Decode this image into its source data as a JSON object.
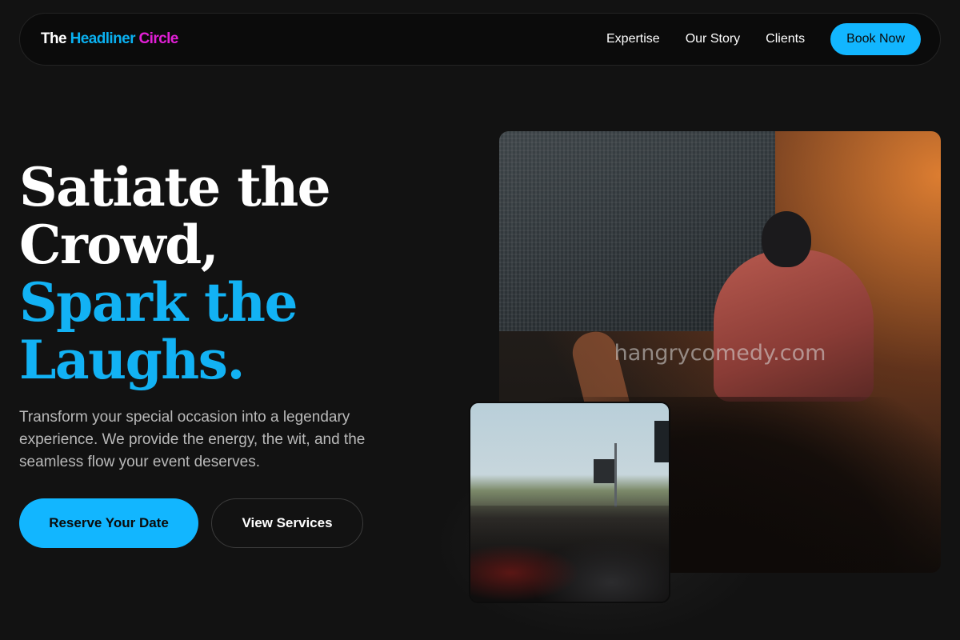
{
  "nav": {
    "logo": {
      "part1": "The",
      "part2": "Headliner",
      "part3": "Circle"
    },
    "links": [
      "Expertise",
      "Our Story",
      "Clients"
    ],
    "cta": "Book Now"
  },
  "hero": {
    "headline_line1": "Satiate the",
    "headline_line2": "Crowd,",
    "headline_line3": "Spark the",
    "headline_line4": "Laughs.",
    "subtitle": "Transform your special occasion into a legendary experience. We provide the energy, the wit, and the seamless flow your event deserves.",
    "primary_button": "Reserve Your Date",
    "secondary_button": "View Services"
  },
  "images": {
    "watermark": "hangrycomedy.com"
  },
  "colors": {
    "accent_blue": "#12b6ff",
    "accent_magenta": "#e21fd6",
    "background": "#121212"
  }
}
